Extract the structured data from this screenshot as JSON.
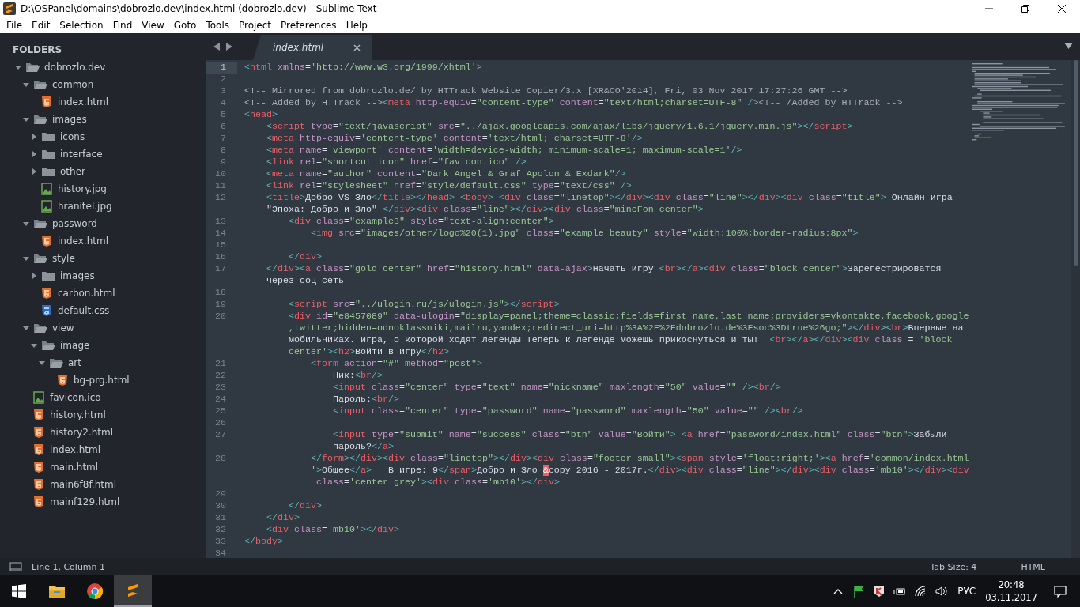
{
  "window": {
    "title": "D:\\OSPanel\\domains\\dobrozlo.dev\\index.html (dobrozlo.dev) - Sublime Text"
  },
  "menu": [
    "File",
    "Edit",
    "Selection",
    "Find",
    "View",
    "Goto",
    "Tools",
    "Project",
    "Preferences",
    "Help"
  ],
  "sidebar": {
    "header": "FOLDERS",
    "tree": [
      {
        "name": "dobrozlo.dev",
        "kind": "folder",
        "expanded": true,
        "children": [
          {
            "name": "common",
            "kind": "folder",
            "expanded": true,
            "children": [
              {
                "name": "index.html",
                "kind": "html"
              }
            ]
          },
          {
            "name": "images",
            "kind": "folder",
            "expanded": true,
            "children": [
              {
                "name": "icons",
                "kind": "folder",
                "expanded": false
              },
              {
                "name": "interface",
                "kind": "folder",
                "expanded": false
              },
              {
                "name": "other",
                "kind": "folder",
                "expanded": false
              },
              {
                "name": "history.jpg",
                "kind": "image"
              },
              {
                "name": "hranitel.jpg",
                "kind": "image"
              }
            ]
          },
          {
            "name": "password",
            "kind": "folder",
            "expanded": true,
            "children": [
              {
                "name": "index.html",
                "kind": "html"
              }
            ]
          },
          {
            "name": "style",
            "kind": "folder",
            "expanded": true,
            "children": [
              {
                "name": "images",
                "kind": "folder",
                "expanded": false
              },
              {
                "name": "carbon.html",
                "kind": "html"
              },
              {
                "name": "default.css",
                "kind": "css"
              }
            ]
          },
          {
            "name": "view",
            "kind": "folder",
            "expanded": true,
            "children": [
              {
                "name": "image",
                "kind": "folder",
                "expanded": true,
                "children": [
                  {
                    "name": "art",
                    "kind": "folder",
                    "expanded": true,
                    "children": [
                      {
                        "name": "bg-prg.html",
                        "kind": "html"
                      }
                    ]
                  }
                ]
              }
            ]
          },
          {
            "name": "favicon.ico",
            "kind": "image"
          },
          {
            "name": "history.html",
            "kind": "html"
          },
          {
            "name": "history2.html",
            "kind": "html"
          },
          {
            "name": "index.html",
            "kind": "html"
          },
          {
            "name": "main.html",
            "kind": "html"
          },
          {
            "name": "main6f8f.html",
            "kind": "html"
          },
          {
            "name": "mainf129.html",
            "kind": "html"
          }
        ]
      }
    ]
  },
  "tabs": [
    {
      "label": "index.html",
      "selected": true
    }
  ],
  "editor": {
    "lines": [
      {
        "number": "1",
        "current": true,
        "text": "<html xmlns='http://www.w3.org/1999/xhtml'>"
      },
      {
        "number": "2",
        "current": false
      },
      {
        "number": "3",
        "current": false,
        "text": "<!-- Mirrored from dobrozlo.de/ by HTTrack Website Copier/3.x [XR&CO'2014], Fri, 03 Nov 2017 17:27:26 GMT -->"
      },
      {
        "number": "4",
        "current": false,
        "text": "<!-- Added by HTTrack --><meta http-equiv=\"content-type\" content=\"text/html;charset=UTF-8\" /><!-- /Added by HTTrack -->"
      },
      {
        "number": "5",
        "current": false,
        "text": "<head>"
      },
      {
        "number": "6",
        "current": false,
        "text": "    <script type=\"text/javascript\" src=\"../ajax.googleapis.com/ajax/libs/jquery/1.6.1/jquery.min.js\"></script>"
      },
      {
        "number": "7",
        "current": false,
        "text": "    <meta http-equiv='content-type' content='text/html; charset=UTF-8'/>"
      },
      {
        "number": "8",
        "current": false,
        "text": "    <meta name='viewport' content='width=device-width; minimum-scale=1; maximum-scale=1'/>"
      },
      {
        "number": "9",
        "current": false,
        "text": "    <link rel=\"shortcut icon\" href=\"favicon.ico\" />"
      },
      {
        "number": "10",
        "current": false,
        "text": "    <meta name=\"author\" content=\"Dark Angel & Graf Apolon & Exdark\"/>"
      },
      {
        "number": "11",
        "current": false,
        "text": "    <link rel=\"stylesheet\" href=\"style/default.css\" type=\"text/css\" />"
      },
      {
        "number": "12",
        "current": false,
        "text": "    <title>Добро VS Зло</title></head> <body> <div class=\"linetop\"></div><div class=\"line\"></div><div class=\"title\"> Онлайн-игра",
        "wrapped": [
          "\"Эпоха: Добро и Зло\" </div><div class=\"line\"></div><div class=\"mineFon center\">"
        ]
      },
      {
        "number": "13",
        "current": false,
        "text": "        <div class=\"example3\" style=\"text-align:center\">"
      },
      {
        "number": "14",
        "current": false,
        "text": "            <img src=\"images/other/logo%20(1).jpg\" class=\"example_beauty\" style=\"width:100%;border-radius:8px\">"
      },
      {
        "number": "15",
        "current": false
      },
      {
        "number": "16",
        "current": false,
        "text": "        </div>"
      },
      {
        "number": "17",
        "current": false,
        "text": "    </div><a class=\"gold center\" href=\"history.html\" data-ajax>Начать игру <br></a><div class=\"block center\">Зарегестрироватся",
        "wrapped": [
          "через соц сеть"
        ]
      },
      {
        "number": "18",
        "current": false
      },
      {
        "number": "19",
        "current": false,
        "text": "        <script src=\"../ulogin.ru/js/ulogin.js\"></script>"
      },
      {
        "number": "20",
        "current": false,
        "text": "        <div id=\"e8457089\" data-ulogin=\"display=panel;theme=classic;fields=first_name,last_name;providers=vkontakte,facebook,google",
        "wrapped": [
          ",twitter;hidden=odnoklassniki,mailru,yandex;redirect_uri=http%3A%2F%2Fdobrozlo.de%3Fsoc%3Dtrue%26go;\"></div><br>Впервые на",
          "мобильниках. Игра, о которой ходят легенды Теперь к легенде можешь прикоснуться и ты!  <br></a></div><div class = 'block",
          "center'><h2>Войти в игру</h2>"
        ]
      },
      {
        "number": "21",
        "current": false,
        "text": "            <form action=\"#\" method=\"post\">"
      },
      {
        "number": "22",
        "current": false,
        "text": "                Ник:<br/>"
      },
      {
        "number": "23",
        "current": false,
        "text": "                <input class=\"center\" type=\"text\" name=\"nickname\" maxlength=\"50\" value=\"\" /><br/>"
      },
      {
        "number": "24",
        "current": false,
        "text": "                Пароль:<br/>"
      },
      {
        "number": "25",
        "current": false,
        "text": "                <input class=\"center\" type=\"password\" name=\"password\" maxlength=\"50\" value=\"\" /><br/>"
      },
      {
        "number": "26",
        "current": false
      },
      {
        "number": "27",
        "current": false,
        "text": "                <input type=\"submit\" name=\"success\" class=\"btn\" value=\"Войти\"> <a href=\"password/index.html\" class=\"btn\">Забыли",
        "wrapped": [
          "пароль?</a>"
        ]
      },
      {
        "number": "28",
        "current": false,
        "text": "            </form></div><div class=\"linetop\"></div><div class=\"footer small\"><span style='float:right;'><a href='common/index.html",
        "wrapped": [
          "'>Общее</a> | В игре: 9</span>Добро и Зло &copy 2016 - 2017г.</div><div class=\"line\"></div><div class='mb10'></div><div",
          " class='center grey'><div class='mb10'></div>"
        ]
      },
      {
        "number": "29",
        "current": false
      },
      {
        "number": "30",
        "current": false,
        "text": "        </div>"
      },
      {
        "number": "31",
        "current": false,
        "text": "    </div>"
      },
      {
        "number": "32",
        "current": false,
        "text": "    <div class='mb10'></div>"
      },
      {
        "number": "33",
        "current": false,
        "text": "</body>"
      },
      {
        "number": "34",
        "current": false
      }
    ]
  },
  "status_bar": {
    "position": "Line 1, Column 1",
    "tab_size": "Tab Size: 4",
    "syntax": "HTML"
  },
  "taskbar": {
    "apps": [
      {
        "kind": "explorer",
        "selected": false
      },
      {
        "kind": "browser",
        "selected": false
      },
      {
        "kind": "editor",
        "selected": true
      }
    ],
    "tray": {
      "language": "РУС",
      "time": "20:48",
      "date": "03.11.2017"
    }
  }
}
